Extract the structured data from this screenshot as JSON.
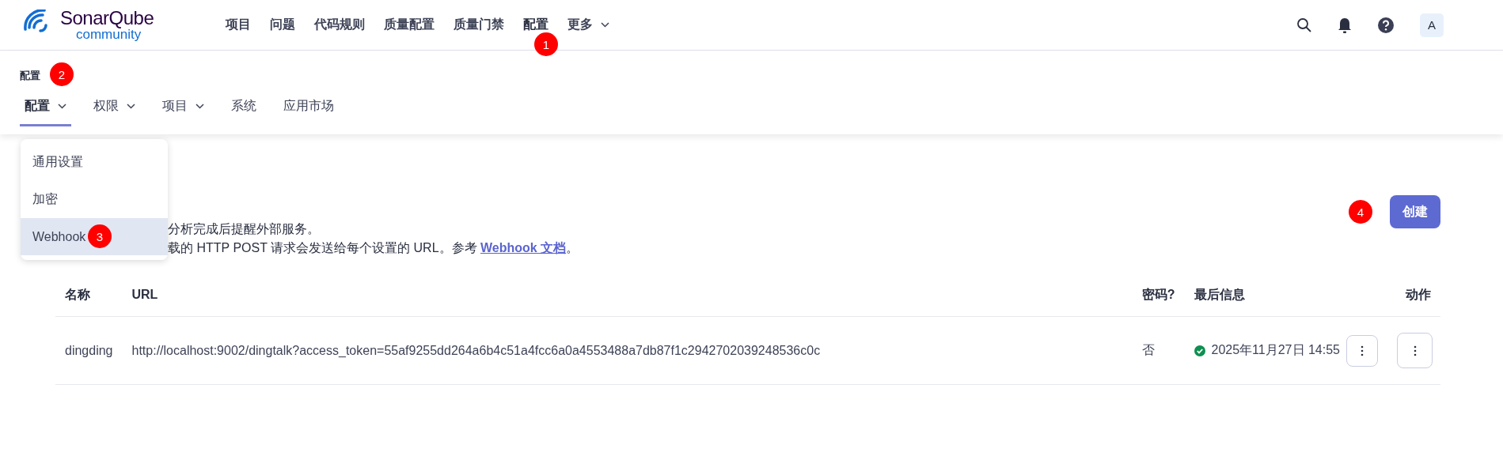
{
  "header": {
    "logo": {
      "name": "SonarQube",
      "edition": "community"
    },
    "nav": [
      {
        "label": "项目",
        "selected": false,
        "dropdown": false
      },
      {
        "label": "问题",
        "selected": false,
        "dropdown": false
      },
      {
        "label": "代码规则",
        "selected": false,
        "dropdown": false
      },
      {
        "label": "质量配置",
        "selected": false,
        "dropdown": false
      },
      {
        "label": "质量门禁",
        "selected": false,
        "dropdown": false
      },
      {
        "label": "配置",
        "selected": true,
        "dropdown": false
      },
      {
        "label": "更多",
        "selected": false,
        "dropdown": true
      }
    ],
    "avatar": "A"
  },
  "subheader": {
    "title": "配置",
    "tabs": [
      {
        "label": "配置",
        "selected": true,
        "dropdown": true
      },
      {
        "label": "权限",
        "selected": false,
        "dropdown": true
      },
      {
        "label": "项目",
        "selected": false,
        "dropdown": true
      },
      {
        "label": "系统",
        "selected": false,
        "dropdown": false
      },
      {
        "label": "应用市场",
        "selected": false,
        "dropdown": false
      }
    ]
  },
  "dropdown": {
    "items": [
      {
        "label": "通用设置",
        "selected": false
      },
      {
        "label": "加密",
        "selected": false
      },
      {
        "label": "Webhook",
        "selected": true
      }
    ]
  },
  "description": [
    {
      "text": "分析完成后提醒外部服务。"
    },
    {
      "text": "载的 HTTP POST 请求会发送给每个设置的 URL。参考 ",
      "link": "Webhook 文档",
      "after": "。"
    }
  ],
  "create_button": "创建",
  "table": {
    "columns": [
      "名称",
      "URL",
      "密码?",
      "最后信息",
      "动作"
    ],
    "rows": [
      {
        "name": "dingding",
        "url": "http://localhost:9002/dingtalk?access_token=55af9255dd264a6b4c51a4fcc6a0a4553488a7db87f1c2942702039248536c0c",
        "secret": "否",
        "last_delivery": {
          "success": true,
          "time": "2025年11月27日 14:55"
        }
      }
    ]
  },
  "callouts": [
    "1",
    "2",
    "3",
    "4"
  ]
}
